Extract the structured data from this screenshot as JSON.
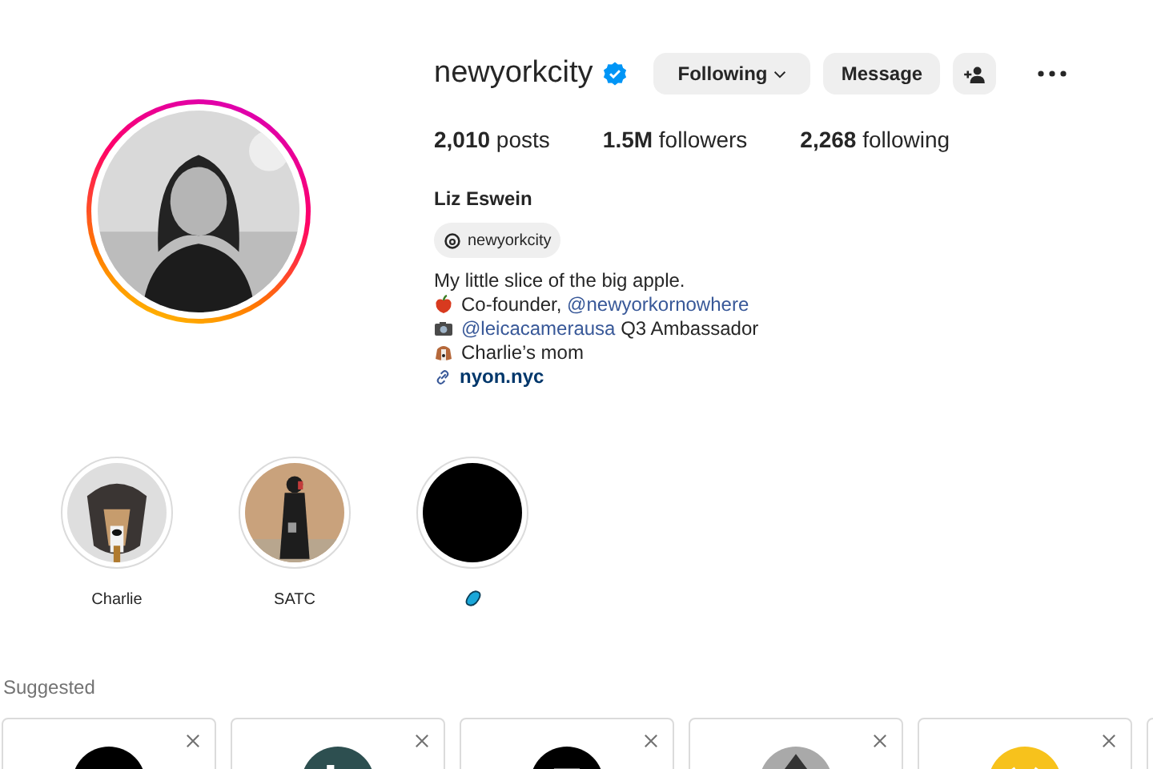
{
  "profile": {
    "username": "newyorkcity",
    "verified": true,
    "buttons": [
      {
        "label": "Following",
        "kind": "dropdown"
      },
      {
        "label": "Message",
        "kind": "plain"
      },
      {
        "kind": "add-person"
      },
      {
        "kind": "more"
      }
    ],
    "stats": [
      {
        "count": "2,010",
        "label": "posts"
      },
      {
        "count": "1.5M",
        "label": "followers"
      },
      {
        "count": "2,268",
        "label": "following"
      }
    ],
    "name": "Liz Eswein",
    "threads_handle": "newyorkcity",
    "bio": [
      {
        "text": "My little slice of the big apple."
      },
      {
        "text": "Co-founder, ",
        "mention": "@newyorkornowhere"
      },
      {
        "mention": "@leicacamerausa",
        "text": " Q3 Ambassador"
      },
      {
        "text": "Charlie’s mom"
      }
    ],
    "link": "nyon.nyc"
  },
  "highlights": [
    {
      "label": "Charlie",
      "kind": "picture"
    },
    {
      "label": "SATC",
      "kind": "picture"
    },
    {
      "kind": "blank"
    }
  ],
  "suggested": {
    "title": "Suggested",
    "cards": [
      {
        "kind": "picture"
      },
      {
        "kind": "picture"
      },
      {
        "kind": "picture"
      },
      {
        "kind": "picture"
      },
      {
        "kind": "picture"
      },
      {
        "kind": "cut"
      }
    ]
  }
}
